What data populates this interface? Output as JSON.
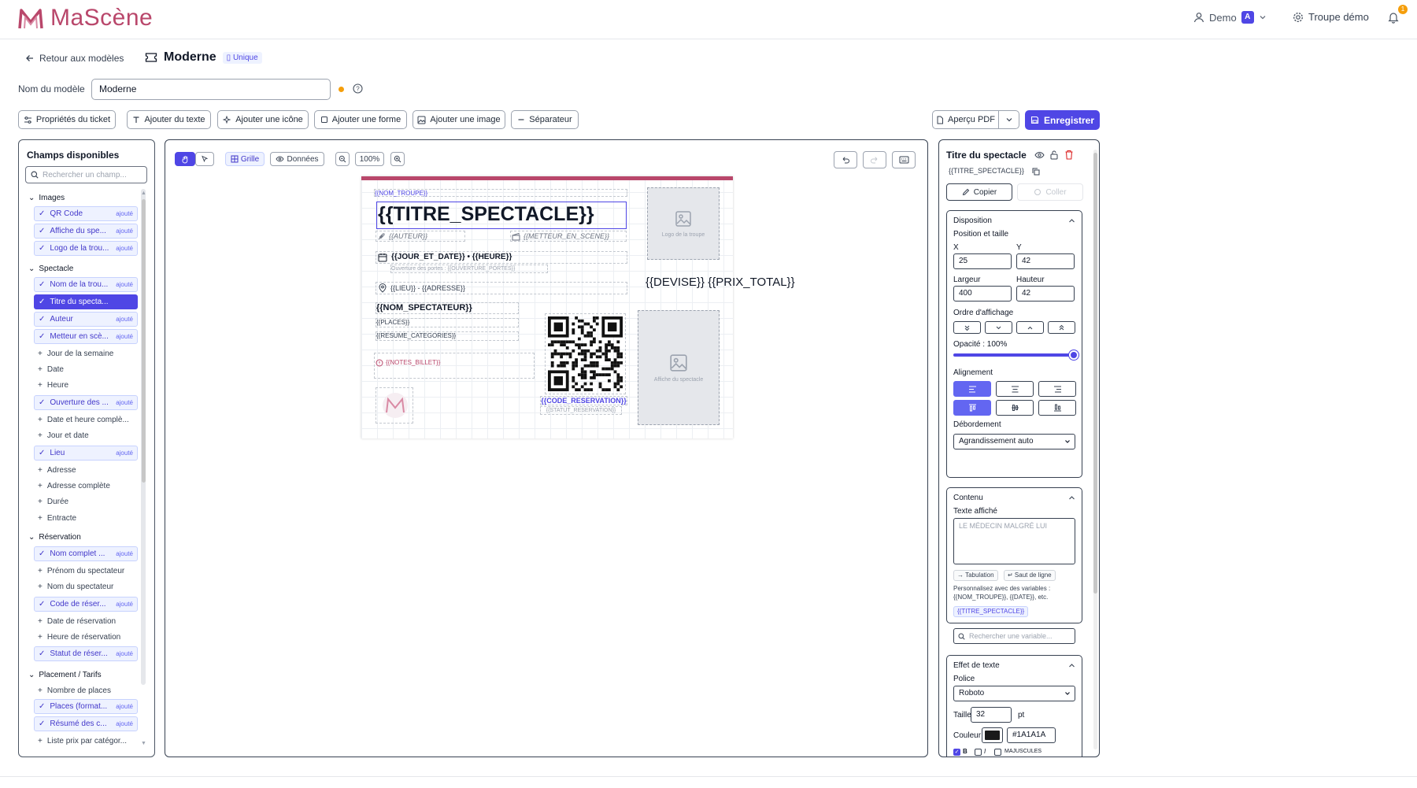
{
  "app": {
    "brand": "MaScène",
    "brand_color": "#b9476b",
    "accent": "#4f46e5"
  },
  "header": {
    "user": "Demo",
    "user_badge": "A",
    "troupe": "Troupe démo",
    "notifications": "1"
  },
  "nav": {
    "back": "Retour aux modèles",
    "template_title": "Moderne",
    "template_tag": "Unique"
  },
  "form": {
    "name_label": "Nom du modèle",
    "name_value": "Moderne"
  },
  "toolbar": {
    "ticket_props": "Propriétés du ticket",
    "add_text": "Ajouter du texte",
    "add_icon": "Ajouter une icône",
    "add_shape": "Ajouter une forme",
    "add_image": "Ajouter une image",
    "separator": "Séparateur",
    "preview_pdf": "Aperçu PDF",
    "save": "Enregistrer"
  },
  "left_panel": {
    "title": "Champs disponibles",
    "search_placeholder": "Rechercher un champ...",
    "added_label": "ajouté",
    "groups": {
      "images": "Images",
      "spectacle": "Spectacle",
      "reservation": "Réservation",
      "placement": "Placement / Tarifs"
    },
    "items": {
      "qr": "QR Code",
      "affiche": "Affiche du spe...",
      "logo": "Logo de la trou...",
      "nom_troupe": "Nom de la trou...",
      "titre": "Titre du specta...",
      "auteur": "Auteur",
      "metteur": "Metteur en scè...",
      "jour_semaine": "Jour de la semaine",
      "date": "Date",
      "heure": "Heure",
      "ouverture": "Ouverture des ...",
      "date_heure": "Date et heure complè...",
      "jour_date": "Jour et date",
      "lieu": "Lieu",
      "adresse": "Adresse",
      "adresse_complete": "Adresse complète",
      "duree": "Durée",
      "entracte": "Entracte",
      "nom_complet": "Nom complet ...",
      "prenom": "Prénom du spectateur",
      "nom_spect": "Nom du spectateur",
      "code_resa": "Code de réser...",
      "date_resa": "Date de réservation",
      "heure_resa": "Heure de réservation",
      "statut_resa": "Statut de réser...",
      "nb_places": "Nombre de places",
      "places_format": "Places (format...",
      "resume": "Résumé des c...",
      "liste_prix": "Liste prix par catégor..."
    }
  },
  "canvas": {
    "grid_label": "Grille",
    "data_label": "Données",
    "zoom": "100%",
    "ticket": {
      "nom_troupe": "{{NOM_TROUPE}}",
      "titre": "{{TITRE_SPECTACLE}}",
      "auteur": "{{AUTEUR}}",
      "metteur": "{{METTEUR_EN_SCENE}}",
      "jour_heure": "{{JOUR_ET_DATE}} • {{HEURE}}",
      "ouverture": "Ouverture des portes : {{OUVERTURE_PORTES}}",
      "lieu_adresse": "{{LIEU}} - {{ADRESSE}}",
      "nom_spectateur": "{{NOM_SPECTATEUR}}",
      "places": "{{PLACES}}",
      "resume": "{{RESUME_CATEGORIES}}",
      "notes": "{{NOTES_BILLET}}",
      "code_resa": "{{CODE_RESERVATION}}",
      "statut": "{{STATUT_RESERVATION}}",
      "logo_placeholder": "Logo de la troupe",
      "affiche_placeholder": "Affiche du spectacle",
      "prix": "{{DEVISE}} {{PRIX_TOTAL}}"
    }
  },
  "right_panel": {
    "element_title": "Titre du spectacle",
    "element_var": "{{TITRE_SPECTACLE}}",
    "copy": "Copier",
    "paste": "Coller",
    "disposition": {
      "title": "Disposition",
      "pos_size": "Position et taille",
      "x_label": "X",
      "x": "25",
      "y_label": "Y",
      "y": "42",
      "w_label": "Largeur",
      "w": "400",
      "h_label": "Hauteur",
      "h": "42",
      "order": "Ordre d'affichage",
      "opacity": "Opacité : 100%",
      "opacity_value": 100,
      "alignment": "Alignement",
      "overflow": "Débordement",
      "overflow_value": "Agrandissement auto"
    },
    "content": {
      "title": "Contenu",
      "text_label": "Texte affiché",
      "text_placeholder": "LE MÉDECIN MALGRÉ LUI",
      "tab_chip": "→ Tabulation",
      "newline_chip": "↵ Saut de ligne",
      "help": "Personnalisez avec des variables :",
      "help2": "{{NOM_TROUPE}}, {{DATE}}, etc.",
      "var_chip": "{{TITRE_SPECTACLE}}",
      "search_placeholder": "Rechercher une variable..."
    },
    "effect": {
      "title": "Effet de texte",
      "font_label": "Police",
      "font": "Roboto",
      "size_label": "Taille",
      "size": "32",
      "unit": "pt",
      "color_label": "Couleur",
      "color": "#1A1A1A",
      "bold": "B",
      "italic": "I",
      "upper": "MAJUSCULES"
    }
  }
}
